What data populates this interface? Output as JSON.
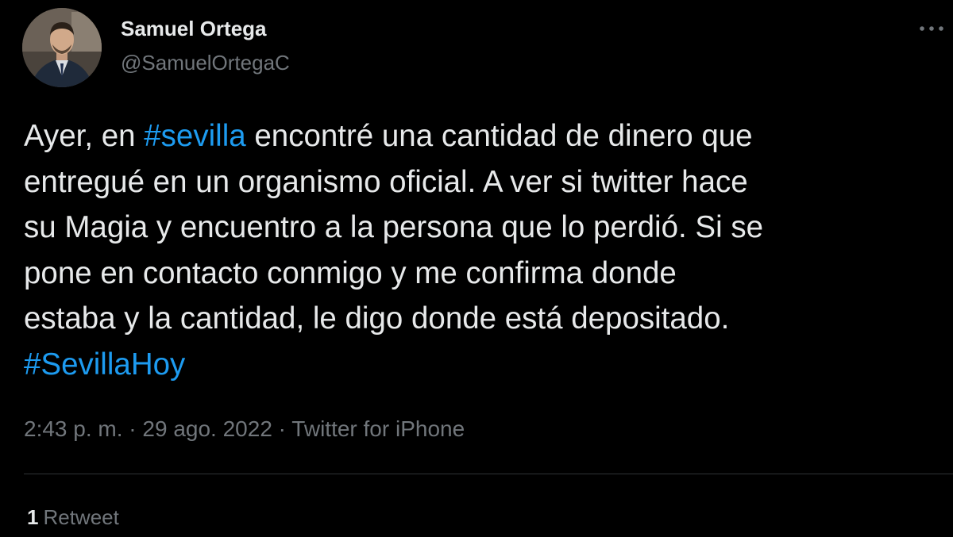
{
  "author": {
    "name": "Samuel Ortega",
    "handle": "@SamuelOrtegaC"
  },
  "more_menu": {
    "icon": "more-horizontal-icon"
  },
  "tweet": {
    "lines": [
      [
        {
          "text": "Ayer, en ",
          "hashtag": false
        },
        {
          "text": "#sevilla",
          "hashtag": true
        },
        {
          "text": " encontré una cantidad de dinero que",
          "hashtag": false
        }
      ],
      [
        {
          "text": "entregué en un organismo oficial. A ver si twitter hace",
          "hashtag": false
        }
      ],
      [
        {
          "text": "su Magia y encuentro a la persona que lo perdió. Si se",
          "hashtag": false
        }
      ],
      [
        {
          "text": "pone en contacto conmigo y me confirma donde",
          "hashtag": false
        }
      ],
      [
        {
          "text": "estaba y la cantidad, le digo donde está depositado.",
          "hashtag": false
        }
      ],
      [
        {
          "text": "#SevillaHoy",
          "hashtag": true
        }
      ]
    ]
  },
  "meta": {
    "time": "2:43 p. m.",
    "separator": " · ",
    "date": "29 ago. 2022",
    "source": "Twitter for iPhone"
  },
  "stats": {
    "retweet_count": "1",
    "retweet_label": "Retweet"
  },
  "colors": {
    "background": "#000000",
    "text": "#e7e9ea",
    "secondary": "#71767b",
    "link": "#1d9bf0",
    "divider": "#2f3336"
  }
}
